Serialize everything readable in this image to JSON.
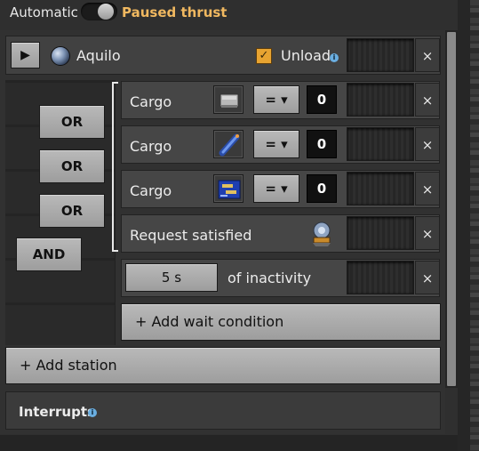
{
  "top": {
    "automatic_label": "Automatic",
    "paused_label": "Paused thrust",
    "toggle_on": true
  },
  "station": {
    "play_glyph": "▶",
    "icon": "planet-icon",
    "name": "Aquilo",
    "unload_checked": true,
    "unload_label": "Unload",
    "info_glyph": "i",
    "close_glyph": "×"
  },
  "logic": {
    "or_labels": [
      "OR",
      "OR",
      "OR"
    ],
    "and_label": "AND"
  },
  "conditions": [
    {
      "label": "Cargo",
      "icon": "concrete-item-icon",
      "op": "= ▾",
      "value": "0",
      "close": "×"
    },
    {
      "label": "Cargo",
      "icon": "rocket-fuel-item-icon",
      "op": "= ▾",
      "value": "0",
      "close": "×"
    },
    {
      "label": "Cargo",
      "icon": "processing-unit-item-icon",
      "op": "= ▾",
      "value": "0",
      "close": "×"
    },
    {
      "label": "Request satisfied",
      "icon": "landing-pad-icon",
      "close": "×"
    }
  ],
  "inactivity": {
    "time": "5 s",
    "label": "of inactivity",
    "close": "×"
  },
  "actions": {
    "add_wait": "+ Add wait condition",
    "add_station": "+ Add station"
  },
  "interrupts": {
    "label": "Interrupts",
    "info_glyph": "i"
  },
  "colors": {
    "accent": "#f0b860",
    "checkbox": "#e8a431",
    "info": "#6aaee0"
  }
}
